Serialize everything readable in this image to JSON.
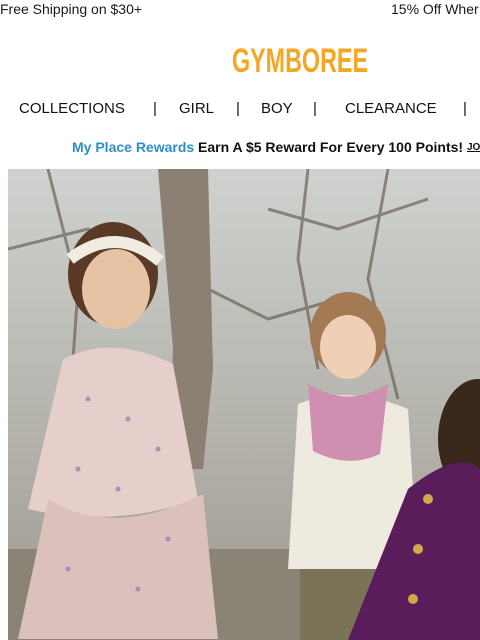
{
  "promo": {
    "left_text": "Free Shipping on $30+",
    "right_text": "15% Off Wher"
  },
  "logo": {
    "text": "GYMBOREE",
    "color": "#f5a623"
  },
  "nav": {
    "items": [
      {
        "label": "COLLECTIONS"
      },
      {
        "label": "GIRL"
      },
      {
        "label": "BOY"
      },
      {
        "label": "CLEARANCE"
      }
    ],
    "separator": "|"
  },
  "rewards": {
    "brand": "My Place Rewards",
    "text": "Earn A $5 Reward For Every 100 Points!",
    "join": "JO",
    "brand_color": "#2f8ec9"
  },
  "hero": {
    "icon": "hero-photo-children-outdoors"
  }
}
